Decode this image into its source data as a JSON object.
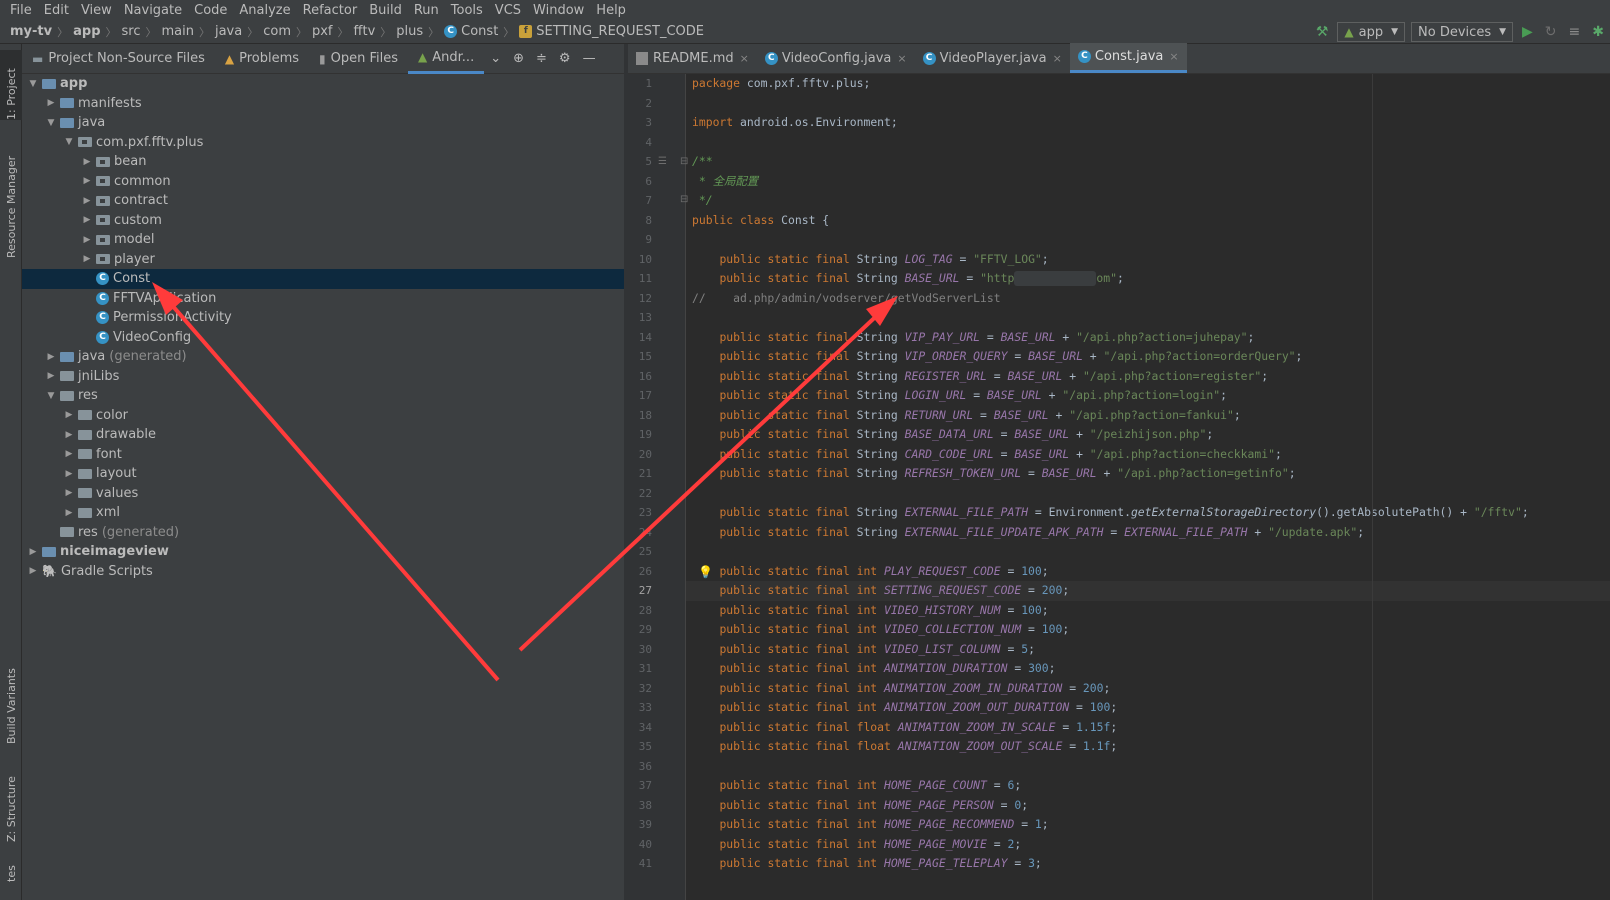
{
  "menu": [
    "File",
    "Edit",
    "View",
    "Navigate",
    "Code",
    "Analyze",
    "Refactor",
    "Build",
    "Run",
    "Tools",
    "VCS",
    "Window",
    "Help"
  ],
  "breadcrumb": [
    "my-tv",
    "app",
    "src",
    "main",
    "java",
    "com",
    "pxf",
    "fftv",
    "plus",
    "Const",
    "SETTING_REQUEST_CODE"
  ],
  "toolbar": {
    "run_config": "app",
    "device": "No Devices"
  },
  "left_strip": {
    "project": "1: Project",
    "resource_manager": "Resource Manager",
    "build_variants": "Build Variants",
    "structure": "Z: Structure",
    "favorites": "tes"
  },
  "project_tabs": [
    "Project Non-Source Files",
    "Problems",
    "Open Files",
    "Andr..."
  ],
  "tree": [
    {
      "label": "app",
      "indent": 0,
      "arrow": "down",
      "icon": "module",
      "bold": true
    },
    {
      "label": "manifests",
      "indent": 1,
      "arrow": "right",
      "icon": "folder-blue"
    },
    {
      "label": "java",
      "indent": 1,
      "arrow": "down",
      "icon": "folder-blue"
    },
    {
      "label": "com.pxf.fftv.plus",
      "indent": 2,
      "arrow": "down",
      "icon": "package"
    },
    {
      "label": "bean",
      "indent": 3,
      "arrow": "right",
      "icon": "package"
    },
    {
      "label": "common",
      "indent": 3,
      "arrow": "right",
      "icon": "package"
    },
    {
      "label": "contract",
      "indent": 3,
      "arrow": "right",
      "icon": "package"
    },
    {
      "label": "custom",
      "indent": 3,
      "arrow": "right",
      "icon": "package"
    },
    {
      "label": "model",
      "indent": 3,
      "arrow": "right",
      "icon": "package"
    },
    {
      "label": "player",
      "indent": 3,
      "arrow": "right",
      "icon": "package"
    },
    {
      "label": "Const",
      "indent": 3,
      "arrow": "none",
      "icon": "class",
      "selected": true
    },
    {
      "label": "FFTVApplication",
      "indent": 3,
      "arrow": "none",
      "icon": "class"
    },
    {
      "label": "PermissionActivity",
      "indent": 3,
      "arrow": "none",
      "icon": "class"
    },
    {
      "label": "VideoConfig",
      "indent": 3,
      "arrow": "none",
      "icon": "class"
    },
    {
      "label": "java",
      "suffix": "(generated)",
      "indent": 1,
      "arrow": "right",
      "icon": "folder-blue"
    },
    {
      "label": "jniLibs",
      "indent": 1,
      "arrow": "right",
      "icon": "folder"
    },
    {
      "label": "res",
      "indent": 1,
      "arrow": "down",
      "icon": "folder"
    },
    {
      "label": "color",
      "indent": 2,
      "arrow": "right",
      "icon": "folder"
    },
    {
      "label": "drawable",
      "indent": 2,
      "arrow": "right",
      "icon": "folder"
    },
    {
      "label": "font",
      "indent": 2,
      "arrow": "right",
      "icon": "folder"
    },
    {
      "label": "layout",
      "indent": 2,
      "arrow": "right",
      "icon": "folder"
    },
    {
      "label": "values",
      "indent": 2,
      "arrow": "right",
      "icon": "folder"
    },
    {
      "label": "xml",
      "indent": 2,
      "arrow": "right",
      "icon": "folder"
    },
    {
      "label": "res",
      "suffix": "(generated)",
      "indent": 1,
      "arrow": "none",
      "icon": "folder"
    },
    {
      "label": "niceimageview",
      "indent": 0,
      "arrow": "right",
      "icon": "module",
      "bold": true
    },
    {
      "label": "Gradle Scripts",
      "indent": 0,
      "arrow": "right",
      "icon": "gradle"
    }
  ],
  "editor_tabs": [
    {
      "label": "README.md",
      "icon": "md",
      "active": false
    },
    {
      "label": "VideoConfig.java",
      "icon": "class",
      "active": false
    },
    {
      "label": "VideoPlayer.java",
      "icon": "class",
      "active": false
    },
    {
      "label": "Const.java",
      "icon": "class",
      "active": true
    }
  ],
  "current_line": 27,
  "code": [
    [
      [
        "kw",
        "package "
      ],
      [
        "",
        "com.pxf.fftv.plus;"
      ]
    ],
    [],
    [
      [
        "kw",
        "import "
      ],
      [
        "",
        "android.os.Environment;"
      ]
    ],
    [],
    [
      [
        "doc",
        "/**"
      ]
    ],
    [
      [
        "doc",
        " * 全局配置"
      ]
    ],
    [
      [
        "doc",
        " */"
      ]
    ],
    [
      [
        "kw",
        "public class "
      ],
      [
        "",
        "Const {"
      ]
    ],
    [],
    [
      [
        "",
        "    "
      ],
      [
        "kw",
        "public static final "
      ],
      [
        "",
        "String "
      ],
      [
        "fld",
        "LOG_TAG"
      ],
      [
        "",
        " = "
      ],
      [
        "str",
        "\"FFTV_LOG\""
      ],
      [
        "",
        ";"
      ]
    ],
    [
      [
        "",
        "    "
      ],
      [
        "kw",
        "public static final "
      ],
      [
        "",
        "String "
      ],
      [
        "fld",
        "BASE_URL"
      ],
      [
        "",
        " = "
      ],
      [
        "str",
        "\"http"
      ],
      [
        "redact",
        ""
      ],
      [
        "str",
        "om\""
      ],
      [
        "",
        ";"
      ]
    ],
    [
      [
        "cmt",
        "//    ad.php/admin/vodserver/getVodServerList"
      ]
    ],
    [],
    [
      [
        "",
        "    "
      ],
      [
        "kw",
        "public static final "
      ],
      [
        "",
        "String "
      ],
      [
        "fld",
        "VIP_PAY_URL"
      ],
      [
        "",
        " = "
      ],
      [
        "fld",
        "BASE_URL"
      ],
      [
        "",
        " + "
      ],
      [
        "str",
        "\"/api.php?action=juhepay\""
      ],
      [
        "",
        ";"
      ]
    ],
    [
      [
        "",
        "    "
      ],
      [
        "kw",
        "public static final "
      ],
      [
        "",
        "String "
      ],
      [
        "fld",
        "VIP_ORDER_QUERY"
      ],
      [
        "",
        " = "
      ],
      [
        "fld",
        "BASE_URL"
      ],
      [
        "",
        " + "
      ],
      [
        "str",
        "\"/api.php?action=orderQuery\""
      ],
      [
        "",
        ";"
      ]
    ],
    [
      [
        "",
        "    "
      ],
      [
        "kw",
        "public static final "
      ],
      [
        "",
        "String "
      ],
      [
        "fld",
        "REGISTER_URL"
      ],
      [
        "",
        " = "
      ],
      [
        "fld",
        "BASE_URL"
      ],
      [
        "",
        " + "
      ],
      [
        "str",
        "\"/api.php?action=register\""
      ],
      [
        "",
        ";"
      ]
    ],
    [
      [
        "",
        "    "
      ],
      [
        "kw",
        "public static final "
      ],
      [
        "",
        "String "
      ],
      [
        "fld",
        "LOGIN_URL"
      ],
      [
        "",
        " = "
      ],
      [
        "fld",
        "BASE_URL"
      ],
      [
        "",
        " + "
      ],
      [
        "str",
        "\"/api.php?action=login\""
      ],
      [
        "",
        ";"
      ]
    ],
    [
      [
        "",
        "    "
      ],
      [
        "kw",
        "public static final "
      ],
      [
        "",
        "String "
      ],
      [
        "fld",
        "RETURN_URL"
      ],
      [
        "",
        " = "
      ],
      [
        "fld",
        "BASE_URL"
      ],
      [
        "",
        " + "
      ],
      [
        "str",
        "\"/api.php?action=fankui\""
      ],
      [
        "",
        ";"
      ]
    ],
    [
      [
        "",
        "    "
      ],
      [
        "kw",
        "public static final "
      ],
      [
        "",
        "String "
      ],
      [
        "fld",
        "BASE_DATA_URL"
      ],
      [
        "",
        " = "
      ],
      [
        "fld",
        "BASE_URL"
      ],
      [
        "",
        " + "
      ],
      [
        "str",
        "\"/peizhijson.php\""
      ],
      [
        "",
        ";"
      ]
    ],
    [
      [
        "",
        "    "
      ],
      [
        "kw",
        "public static final "
      ],
      [
        "",
        "String "
      ],
      [
        "fld",
        "CARD_CODE_URL"
      ],
      [
        "",
        " = "
      ],
      [
        "fld",
        "BASE_URL"
      ],
      [
        "",
        " + "
      ],
      [
        "str",
        "\"/api.php?action=checkkami\""
      ],
      [
        "",
        ";"
      ]
    ],
    [
      [
        "",
        "    "
      ],
      [
        "kw",
        "public static final "
      ],
      [
        "",
        "String "
      ],
      [
        "fld",
        "REFRESH_TOKEN_URL"
      ],
      [
        "",
        " = "
      ],
      [
        "fld",
        "BASE_URL"
      ],
      [
        "",
        " + "
      ],
      [
        "str",
        "\"/api.php?action=getinfo\""
      ],
      [
        "",
        ";"
      ]
    ],
    [],
    [
      [
        "",
        "    "
      ],
      [
        "kw",
        "public static final "
      ],
      [
        "",
        "String "
      ],
      [
        "fld",
        "EXTERNAL_FILE_PATH"
      ],
      [
        "",
        " = Environment."
      ],
      [
        "mth",
        "getExternalStorageDirectory"
      ],
      [
        "",
        "().getAbsolutePath() + "
      ],
      [
        "str",
        "\"/fftv\""
      ],
      [
        "",
        ";"
      ]
    ],
    [
      [
        "",
        "    "
      ],
      [
        "kw",
        "public static final "
      ],
      [
        "",
        "String "
      ],
      [
        "fld",
        "EXTERNAL_FILE_UPDATE_APK_PATH"
      ],
      [
        "",
        " = "
      ],
      [
        "fld",
        "EXTERNAL_FILE_PATH"
      ],
      [
        "",
        " + "
      ],
      [
        "str",
        "\"/update.apk\""
      ],
      [
        "",
        ";"
      ]
    ],
    [],
    [
      [
        "",
        "    "
      ],
      [
        "kw",
        "public static final int "
      ],
      [
        "fld",
        "PLAY_REQUEST_CODE"
      ],
      [
        "",
        " = "
      ],
      [
        "num",
        "100"
      ],
      [
        "",
        ";"
      ]
    ],
    [
      [
        "",
        "    "
      ],
      [
        "kw",
        "public static final int "
      ],
      [
        "fld",
        "SETTING_REQUEST_CODE"
      ],
      [
        "",
        " = "
      ],
      [
        "num",
        "200"
      ],
      [
        "",
        ";"
      ]
    ],
    [
      [
        "",
        "    "
      ],
      [
        "kw",
        "public static final int "
      ],
      [
        "fld",
        "VIDEO_HISTORY_NUM"
      ],
      [
        "",
        " = "
      ],
      [
        "num",
        "100"
      ],
      [
        "",
        ";"
      ]
    ],
    [
      [
        "",
        "    "
      ],
      [
        "kw",
        "public static final int "
      ],
      [
        "fld",
        "VIDEO_COLLECTION_NUM"
      ],
      [
        "",
        " = "
      ],
      [
        "num",
        "100"
      ],
      [
        "",
        ";"
      ]
    ],
    [
      [
        "",
        "    "
      ],
      [
        "kw",
        "public static final int "
      ],
      [
        "fld",
        "VIDEO_LIST_COLUMN"
      ],
      [
        "",
        " = "
      ],
      [
        "num",
        "5"
      ],
      [
        "",
        ";"
      ]
    ],
    [
      [
        "",
        "    "
      ],
      [
        "kw",
        "public static final int "
      ],
      [
        "fld",
        "ANIMATION_DURATION"
      ],
      [
        "",
        " = "
      ],
      [
        "num",
        "300"
      ],
      [
        "",
        ";"
      ]
    ],
    [
      [
        "",
        "    "
      ],
      [
        "kw",
        "public static final int "
      ],
      [
        "fld",
        "ANIMATION_ZOOM_IN_DURATION"
      ],
      [
        "",
        " = "
      ],
      [
        "num",
        "200"
      ],
      [
        "",
        ";"
      ]
    ],
    [
      [
        "",
        "    "
      ],
      [
        "kw",
        "public static final int "
      ],
      [
        "fld",
        "ANIMATION_ZOOM_OUT_DURATION"
      ],
      [
        "",
        " = "
      ],
      [
        "num",
        "100"
      ],
      [
        "",
        ";"
      ]
    ],
    [
      [
        "",
        "    "
      ],
      [
        "kw",
        "public static final float "
      ],
      [
        "fld",
        "ANIMATION_ZOOM_IN_SCALE"
      ],
      [
        "",
        " = "
      ],
      [
        "num",
        "1.15f"
      ],
      [
        "",
        ";"
      ]
    ],
    [
      [
        "",
        "    "
      ],
      [
        "kw",
        "public static final float "
      ],
      [
        "fld",
        "ANIMATION_ZOOM_OUT_SCALE"
      ],
      [
        "",
        " = "
      ],
      [
        "num",
        "1.1f"
      ],
      [
        "",
        ";"
      ]
    ],
    [],
    [
      [
        "",
        "    "
      ],
      [
        "kw",
        "public static final int "
      ],
      [
        "fld",
        "HOME_PAGE_COUNT"
      ],
      [
        "",
        " = "
      ],
      [
        "num",
        "6"
      ],
      [
        "",
        ";"
      ]
    ],
    [
      [
        "",
        "    "
      ],
      [
        "kw",
        "public static final int "
      ],
      [
        "fld",
        "HOME_PAGE_PERSON"
      ],
      [
        "",
        " = "
      ],
      [
        "num",
        "0"
      ],
      [
        "",
        ";"
      ]
    ],
    [
      [
        "",
        "    "
      ],
      [
        "kw",
        "public static final int "
      ],
      [
        "fld",
        "HOME_PAGE_RECOMMEND"
      ],
      [
        "",
        " = "
      ],
      [
        "num",
        "1"
      ],
      [
        "",
        ";"
      ]
    ],
    [
      [
        "",
        "    "
      ],
      [
        "kw",
        "public static final int "
      ],
      [
        "fld",
        "HOME_PAGE_MOVIE"
      ],
      [
        "",
        " = "
      ],
      [
        "num",
        "2"
      ],
      [
        "",
        ";"
      ]
    ],
    [
      [
        "",
        "    "
      ],
      [
        "kw",
        "public static final int "
      ],
      [
        "fld",
        "HOME_PAGE_TELEPLAY"
      ],
      [
        "",
        " = "
      ],
      [
        "num",
        "3"
      ],
      [
        "",
        ";"
      ]
    ]
  ],
  "colors": {
    "keyword": "#cc7832",
    "field": "#9876aa",
    "string": "#6a8759",
    "number": "#6897bb",
    "annotation_arrow": "#ff3b3b",
    "selection": "#0d293e"
  }
}
